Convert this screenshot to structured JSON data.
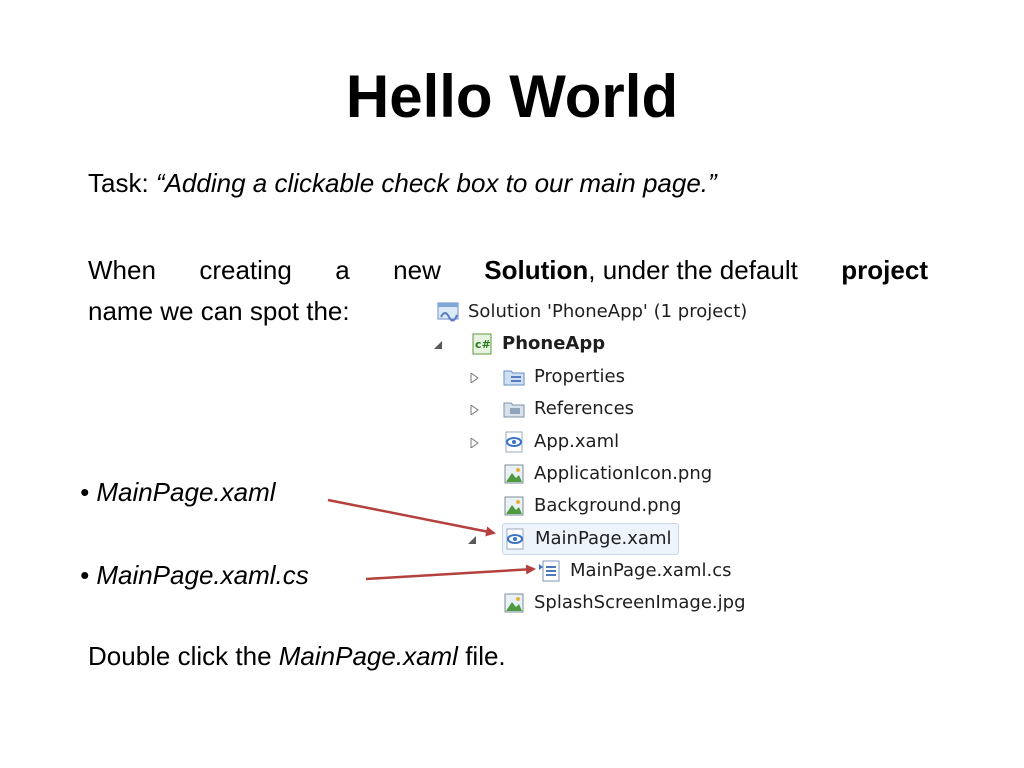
{
  "slide": {
    "title": "Hello World",
    "task_label": "Task: ",
    "task_text": "“Adding a clickable check box to our main page.”",
    "para_line1_words": [
      "When",
      "creating",
      "a",
      "new"
    ],
    "para_bold1": "Solution",
    "para_after_bold1": ", under the default",
    "para_bold2": "project",
    "para_line2": "name we can spot the:",
    "bullet1": "MainPage.xaml",
    "bullet2": "MainPage.xaml.cs",
    "dbl_prefix": "Double click the ",
    "dbl_italic": "MainPage.xaml",
    "dbl_suffix": " file."
  },
  "tree": {
    "solution": "Solution 'PhoneApp' (1 project)",
    "project": "PhoneApp",
    "items": [
      {
        "label": "Properties",
        "icon": "properties-icon"
      },
      {
        "label": "References",
        "icon": "references-icon"
      },
      {
        "label": "App.xaml",
        "icon": "xaml-icon"
      },
      {
        "label": "ApplicationIcon.png",
        "icon": "image-icon"
      },
      {
        "label": "Background.png",
        "icon": "image-icon"
      },
      {
        "label": "MainPage.xaml",
        "icon": "xaml-icon"
      },
      {
        "label": "MainPage.xaml.cs",
        "icon": "cs-file-icon"
      },
      {
        "label": "SplashScreenImage.jpg",
        "icon": "image-icon"
      }
    ]
  },
  "colors": {
    "arrow": "#b5413f",
    "selection": "#eef4fb"
  }
}
